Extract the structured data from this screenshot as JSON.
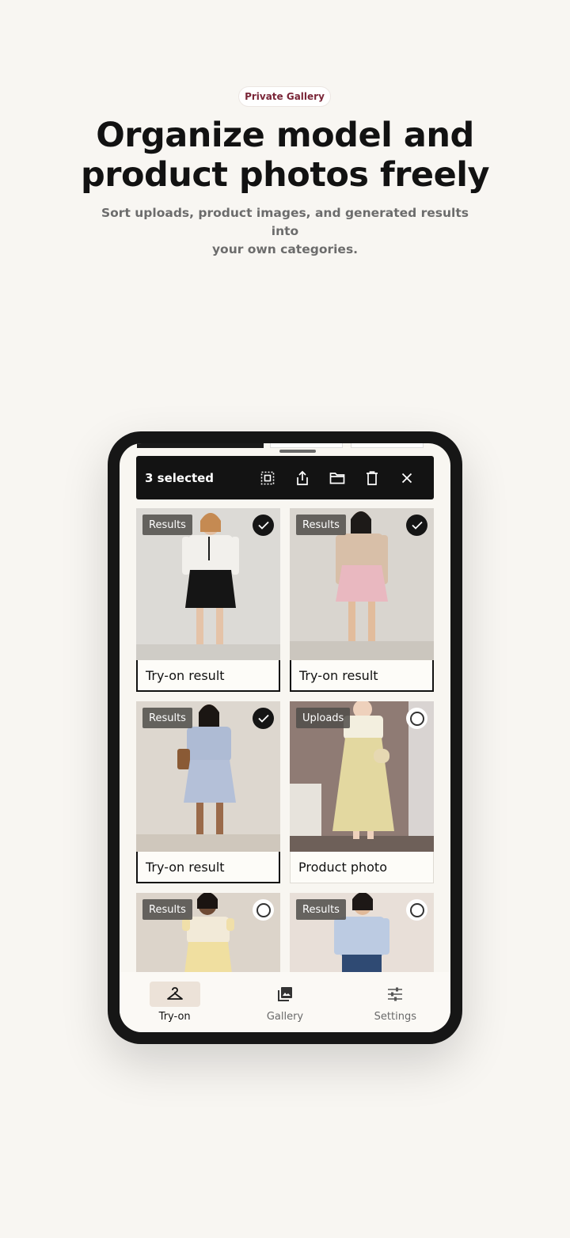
{
  "header": {
    "badge": "Private Gallery",
    "title_line1": "Organize model and",
    "title_line2": "product photos freely",
    "subtitle_line1": "Sort uploads, product images, and generated results into",
    "subtitle_line2": "your own categories."
  },
  "selection_bar": {
    "count_label": "3 selected",
    "actions": [
      "select-all-icon",
      "share-icon",
      "folder-icon",
      "delete-icon",
      "close-icon"
    ]
  },
  "gallery": {
    "items": [
      {
        "tag": "Results",
        "caption": "Try-on result",
        "selected": true
      },
      {
        "tag": "Results",
        "caption": "Try-on result",
        "selected": true
      },
      {
        "tag": "Results",
        "caption": "Try-on result",
        "selected": true
      },
      {
        "tag": "Uploads",
        "caption": "Product photo",
        "selected": false
      },
      {
        "tag": "Results",
        "caption": "",
        "selected": false
      },
      {
        "tag": "Results",
        "caption": "",
        "selected": false
      }
    ]
  },
  "tabbar": {
    "tabs": [
      {
        "label": "Try-on",
        "icon": "hanger-icon",
        "active": true
      },
      {
        "label": "Gallery",
        "icon": "gallery-icon",
        "active": false
      },
      {
        "label": "Settings",
        "icon": "sliders-icon",
        "active": false
      }
    ]
  },
  "colors": {
    "background": "#f8f6f2",
    "badge_text": "#7a2638",
    "selection_bar": "#131313",
    "active_tab": "#ece2d8"
  }
}
